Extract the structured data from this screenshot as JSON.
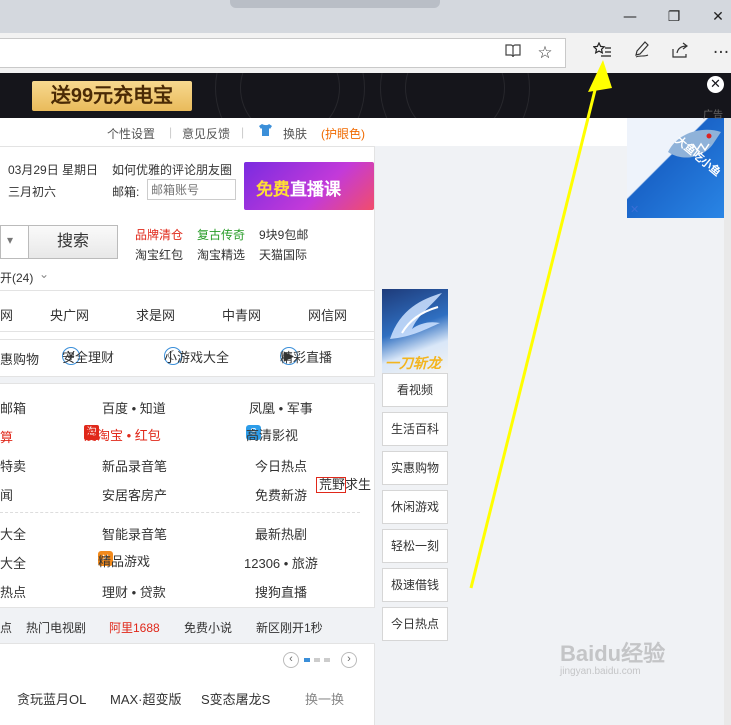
{
  "browser": {
    "window_controls": {
      "minimize": "—",
      "restore": "❐",
      "close": "✕"
    },
    "toolbar_icons": [
      "reading-view-icon",
      "favorite-star-icon",
      "favorites-hub-icon",
      "pen-icon",
      "share-icon",
      "more-icon"
    ],
    "more_label": "···"
  },
  "banner": {
    "button_label": "送99元充电宝",
    "close_label": "✕"
  },
  "settings_bar": {
    "items": [
      "个性设置",
      "意见反馈",
      "换肤",
      "(护眼色)"
    ]
  },
  "info": {
    "date": "03月29日 星期日",
    "lunar": "三月初六",
    "note_label": "如何优雅的评论朋友圈",
    "mail_label": "邮箱:",
    "mail_placeholder": "邮箱账号"
  },
  "promo_ad": {
    "part1": "免费",
    "part2": "直播课"
  },
  "search": {
    "button_label": "搜索",
    "dropdown": "▾"
  },
  "hot_links": {
    "row1": [
      "品牌清仓",
      "复古传奇",
      "9块9包邮"
    ],
    "row2": [
      "淘宝红包",
      "淘宝精选",
      "天猫国际"
    ]
  },
  "expand_label": "开(24)",
  "site_row": [
    "网",
    "央广网",
    "求是网",
    "中青网",
    "网信网"
  ],
  "feature_row": [
    "惠购物",
    "安全理财",
    "小游戏大全",
    "精彩直播"
  ],
  "grid": {
    "r1": [
      "邮箱",
      "百度 • 知道",
      "凤凰 • 军事"
    ],
    "r2": [
      "算",
      "爱淘宝 • 红包",
      "高清影视"
    ],
    "r3": [
      "特卖",
      "新品录音笔",
      "今日热点"
    ],
    "r4": [
      "闻",
      "安居客房产",
      "免费新游"
    ],
    "badge": "荒野求生",
    "r5": [
      "大全",
      "智能录音笔",
      "最新热剧"
    ],
    "r6": [
      "大全",
      "精品游戏",
      "12306 • 旅游"
    ],
    "r7": [
      "热点",
      "理财 • 贷款",
      "搜狗直播"
    ]
  },
  "bottom_links": [
    "点",
    "热门电视剧",
    "阿里1688",
    "免费小说",
    "新区刚开1秒"
  ],
  "games": {
    "items": [
      "贪玩蓝月OL",
      "MAX·超变版",
      "S变态屠龙S"
    ],
    "swap": "换一换"
  },
  "side_buttons": [
    "看视频",
    "生活百科",
    "实惠购物",
    "休闲游戏",
    "轻松一刻",
    "极速借钱",
    "今日热点"
  ],
  "game_ad_brand": "一刀斩龙",
  "side_ad": {
    "label": "广告",
    "text": "大鱼吃小鱼",
    "close": "✕"
  },
  "watermark": {
    "main": "Baidu经验",
    "sub": "jingyan.baidu.com"
  },
  "colors": {
    "arrow": "#ffff00",
    "accent_red": "#e0281a",
    "link_blue": "#3b8fd9"
  }
}
